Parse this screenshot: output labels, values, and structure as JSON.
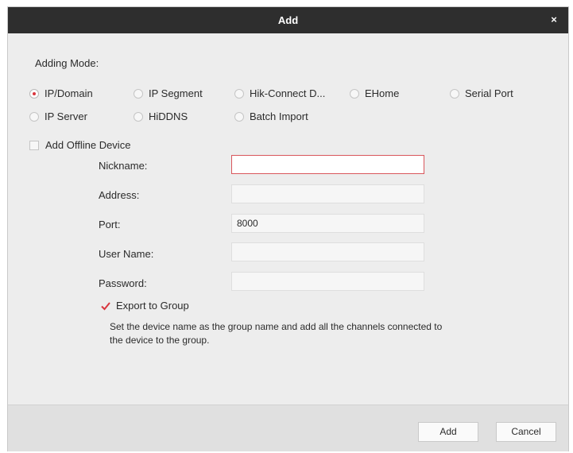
{
  "dialog": {
    "title": "Add",
    "close_glyph": "×"
  },
  "adding_mode": {
    "label": "Adding Mode:",
    "selected": "IP/Domain",
    "options": [
      "IP/Domain",
      "IP Segment",
      "Hik-Connect D...",
      "EHome",
      "Serial Port",
      "IP Server",
      "HiDDNS",
      "Batch Import"
    ]
  },
  "offline_device": {
    "label": "Add Offline Device",
    "checked": false
  },
  "form": {
    "nickname": {
      "label": "Nickname:",
      "value": ""
    },
    "address": {
      "label": "Address:",
      "value": ""
    },
    "port": {
      "label": "Port:",
      "value": "8000"
    },
    "username": {
      "label": "User Name:",
      "value": ""
    },
    "password": {
      "label": "Password:",
      "value": ""
    }
  },
  "export_group": {
    "label": "Export to Group",
    "checked": true,
    "hint": "Set the device name as the group name and add all the channels connected to the device to the group."
  },
  "buttons": {
    "add": "Add",
    "cancel": "Cancel"
  },
  "colors": {
    "titlebar": "#2e2e2e",
    "accent": "#d9363e",
    "dialog_bg": "#ededed"
  },
  "icons": {
    "close": "close-icon",
    "check": "checkmark-icon"
  }
}
